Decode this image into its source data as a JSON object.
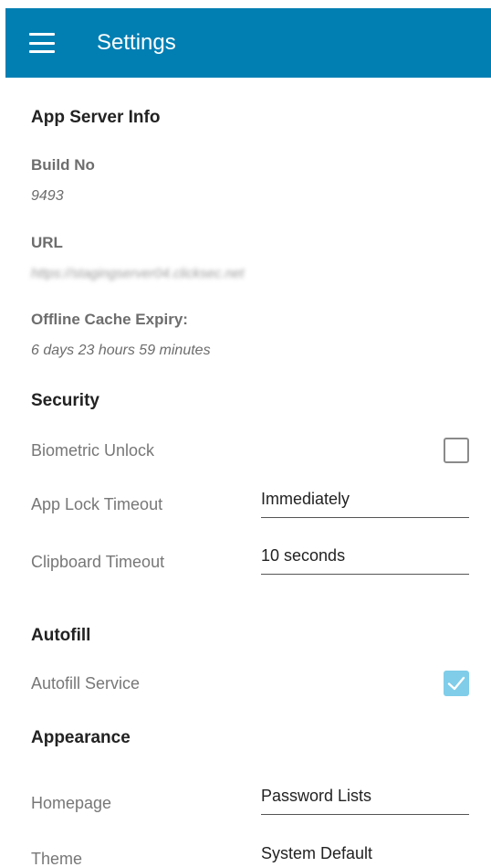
{
  "appbar": {
    "title": "Settings",
    "menu_icon": "hamburger-menu-icon",
    "background_color": "#017fb3"
  },
  "app_server_info": {
    "title": "App Server Info",
    "build_no_label": "Build No",
    "build_no_value": "9493",
    "url_label": "URL",
    "url_value": "https://stagingserver04.clicksec.net",
    "cache_expiry_label": "Offline Cache Expiry:",
    "cache_expiry_value": "6 days 23 hours 59 minutes"
  },
  "security": {
    "title": "Security",
    "biometric_label": "Biometric Unlock",
    "biometric_checked": false,
    "app_lock_label": "App Lock Timeout",
    "app_lock_value": "Immediately",
    "clipboard_label": "Clipboard Timeout",
    "clipboard_value": "10 seconds"
  },
  "autofill": {
    "title": "Autofill",
    "service_label": "Autofill Service",
    "service_checked": true,
    "checkbox_color": "#7fcde9"
  },
  "appearance": {
    "title": "Appearance",
    "homepage_label": "Homepage",
    "homepage_value": "Password Lists",
    "theme_label": "Theme",
    "theme_value": "System Default"
  }
}
